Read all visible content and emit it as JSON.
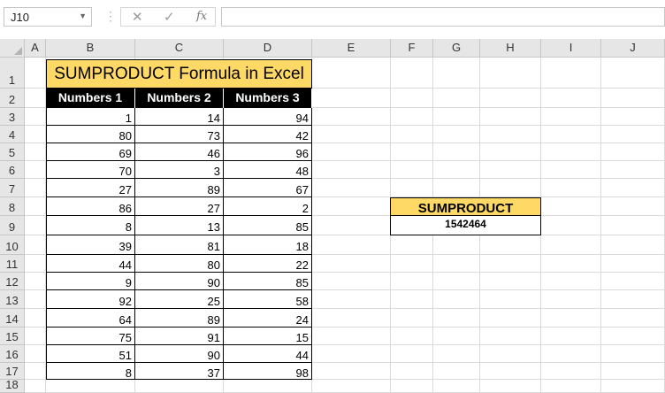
{
  "formula_bar": {
    "name_box": "J10",
    "separator": "⋮",
    "cancel_icon": "✕",
    "enter_icon": "✓",
    "function_icon": "fx",
    "formula": ""
  },
  "columns": [
    "A",
    "B",
    "C",
    "D",
    "E",
    "F",
    "G",
    "H",
    "I",
    "J"
  ],
  "rows": [
    "1",
    "2",
    "3",
    "4",
    "5",
    "6",
    "7",
    "8",
    "9",
    "10",
    "11",
    "12",
    "13",
    "14",
    "15",
    "16",
    "17",
    "18"
  ],
  "table": {
    "title": "SUMPRODUCT Formula in Excel",
    "headers": [
      "Numbers 1",
      "Numbers 2",
      "Numbers 3"
    ],
    "data": [
      [
        "1",
        "14",
        "94"
      ],
      [
        "80",
        "73",
        "42"
      ],
      [
        "69",
        "46",
        "96"
      ],
      [
        "70",
        "3",
        "48"
      ],
      [
        "27",
        "89",
        "67"
      ],
      [
        "86",
        "27",
        "2"
      ],
      [
        "8",
        "13",
        "85"
      ],
      [
        "39",
        "81",
        "18"
      ],
      [
        "44",
        "80",
        "22"
      ],
      [
        "9",
        "90",
        "85"
      ],
      [
        "92",
        "25",
        "58"
      ],
      [
        "64",
        "89",
        "24"
      ],
      [
        "75",
        "91",
        "15"
      ],
      [
        "51",
        "90",
        "44"
      ],
      [
        "8",
        "37",
        "98"
      ]
    ]
  },
  "result": {
    "label": "SUMPRODUCT",
    "value": "1542464"
  },
  "colors": {
    "title_fill": "#FFD966",
    "header_fill": "#000000",
    "grid_line": "#DADADA",
    "header_bg": "#E6E6E6"
  }
}
